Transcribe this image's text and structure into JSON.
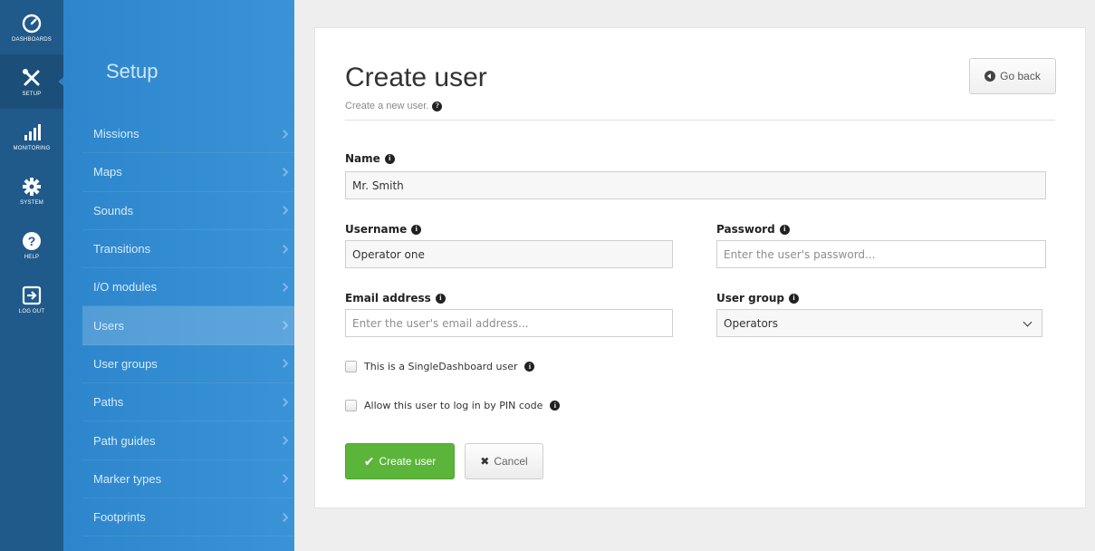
{
  "rail": {
    "items": [
      {
        "label": "DASHBOARDS",
        "icon": "dashboard-gauge-icon"
      },
      {
        "label": "SETUP",
        "icon": "wrench-screwdriver-icon"
      },
      {
        "label": "MONITORING",
        "icon": "signal-bars-icon"
      },
      {
        "label": "SYSTEM",
        "icon": "gear-icon"
      },
      {
        "label": "HELP",
        "icon": "question-circle-icon"
      },
      {
        "label": "LOG OUT",
        "icon": "logout-icon"
      }
    ]
  },
  "menu": {
    "title": "Setup",
    "items": [
      {
        "label": "Missions"
      },
      {
        "label": "Maps"
      },
      {
        "label": "Sounds"
      },
      {
        "label": "Transitions"
      },
      {
        "label": "I/O modules"
      },
      {
        "label": "Users"
      },
      {
        "label": "User groups"
      },
      {
        "label": "Paths"
      },
      {
        "label": "Path guides"
      },
      {
        "label": "Marker types"
      },
      {
        "label": "Footprints"
      }
    ]
  },
  "page": {
    "title": "Create user",
    "subtitle": "Create a new user.",
    "go_back": "Go back"
  },
  "form": {
    "name_label": "Name",
    "name_value": "Mr. Smith",
    "username_label": "Username",
    "username_value": "Operator one",
    "password_label": "Password",
    "password_placeholder": "Enter the user's password...",
    "email_label": "Email address",
    "email_placeholder": "Enter the user's email address...",
    "usergroup_label": "User group",
    "usergroup_value": "Operators",
    "singledashboard_label": "This is a SingleDashboard user",
    "pin_label": "Allow this user to log in by PIN code",
    "create_button": "Create user",
    "cancel_button": "Cancel"
  },
  "colors": {
    "rail": "#1f5a8a",
    "menu": "#2d86cc",
    "create_button": "#5bb53b"
  }
}
